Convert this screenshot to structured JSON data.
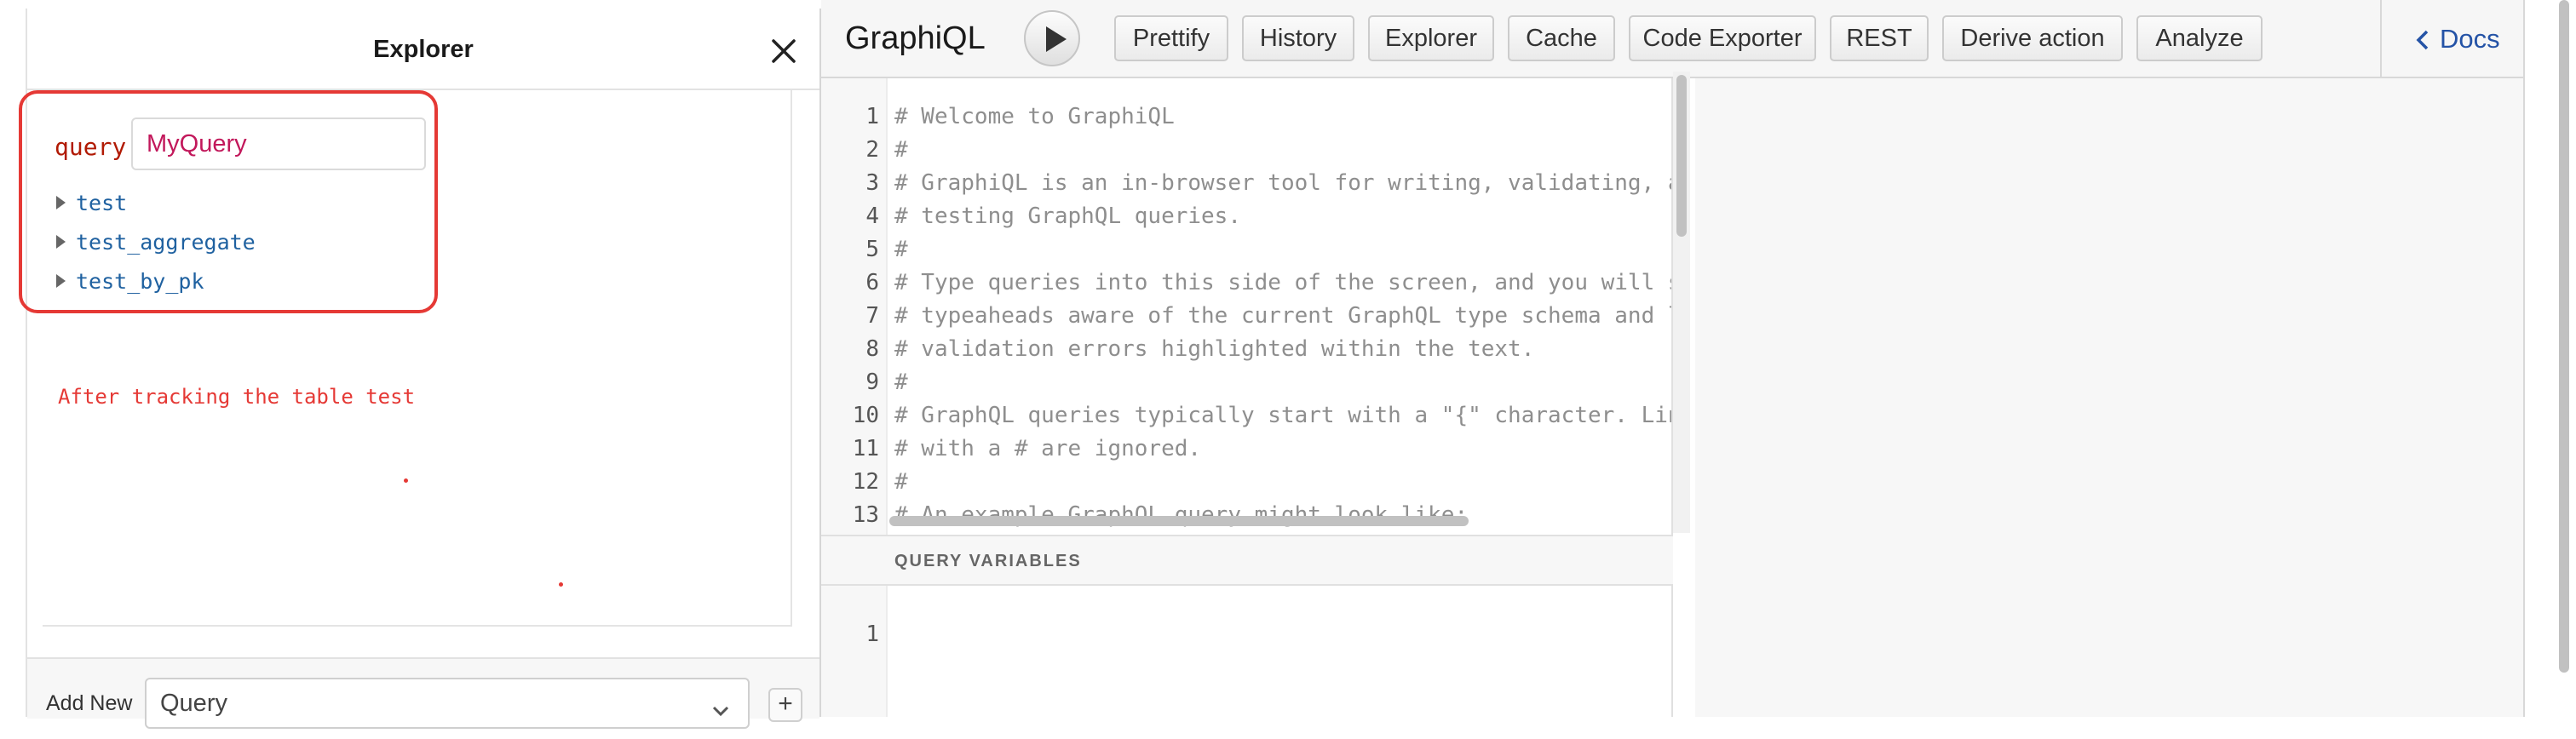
{
  "explorer": {
    "title": "Explorer",
    "operation_keyword": "query",
    "operation_name": "MyQuery",
    "fields": [
      "test",
      "test_aggregate",
      "test_by_pk"
    ],
    "annotation_text": "After tracking the table test",
    "add_new_label": "Add New",
    "add_new_selected": "Query",
    "add_new_button": "+"
  },
  "toolbar": {
    "title": "GraphiQL",
    "buttons": [
      "Prettify",
      "History",
      "Explorer",
      "Cache",
      "Code Exporter",
      "REST",
      "Derive action",
      "Analyze"
    ],
    "docs": "Docs"
  },
  "editor": {
    "line_numbers": [
      "1",
      "2",
      "3",
      "4",
      "5",
      "6",
      "7",
      "8",
      "9",
      "10",
      "11",
      "12",
      "13"
    ],
    "lines": [
      "# Welcome to GraphiQL",
      "#",
      "# GraphiQL is an in-browser tool for writing, validating, and",
      "# testing GraphQL queries.",
      "#",
      "# Type queries into this side of the screen, and you will see intelligent",
      "# typeaheads aware of the current GraphQL type schema and live syntax and",
      "# validation errors highlighted within the text.",
      "#",
      "# GraphQL queries typically start with a \"{\" character. Lines that start",
      "# with a # are ignored.",
      "#",
      "# An example GraphQL query might look like:"
    ]
  },
  "variables": {
    "title": "QUERY VARIABLES",
    "line_numbers": [
      "1"
    ]
  },
  "colors": {
    "annotation": "#e53935",
    "keyword": "#b11a04",
    "field": "#1f61a0",
    "operation_name": "#c2185b",
    "docs_link": "#2453a6"
  }
}
